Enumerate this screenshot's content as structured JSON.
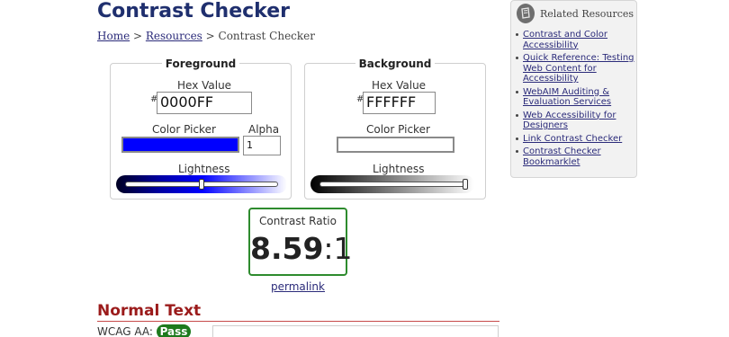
{
  "page": {
    "title": "Contrast Checker"
  },
  "breadcrumb": {
    "home": "Home",
    "sep1": " > ",
    "resources": "Resources",
    "sep2": " > ",
    "current": "Contrast Checker"
  },
  "foreground": {
    "title": "Foreground",
    "hex_label": "Hex Value",
    "hash": "#",
    "hex_value": "0000FF",
    "picker_label": "Color Picker",
    "alpha_label": "Alpha",
    "alpha_value": "1",
    "color": "#0000ff",
    "lightness_label": "Lightness",
    "lightness_level": 0.5
  },
  "background": {
    "title": "Background",
    "hex_label": "Hex Value",
    "hash": "#",
    "hex_value": "FFFFFF",
    "picker_label": "Color Picker",
    "color": "#ffffff",
    "lightness_label": "Lightness",
    "lightness_level": 1.0
  },
  "contrast": {
    "label": "Contrast Ratio",
    "value": "8.59",
    "suffix": ":1",
    "permalink": "permalink"
  },
  "normal_text": {
    "heading": "Normal Text",
    "wcag_aa_label": "WCAG AA:",
    "wcag_aa_status": "Pass"
  },
  "related": {
    "title": "Related Resources",
    "icon": "book-icon",
    "items": [
      "Contrast and Color Accessibility",
      "Quick Reference: Testing Web Content for Accessibility",
      "WebAIM Auditing & Evaluation Services",
      "Web Accessibility for Designers",
      "Link Contrast Checker",
      "Contrast Checker Bookmarklet"
    ]
  },
  "colors": {
    "title": "#1f2f6e",
    "link": "#2b2b7a",
    "pass": "#1d7a1d",
    "heading_red": "#9b1b1b",
    "ratio_border": "#2e8b2e"
  }
}
